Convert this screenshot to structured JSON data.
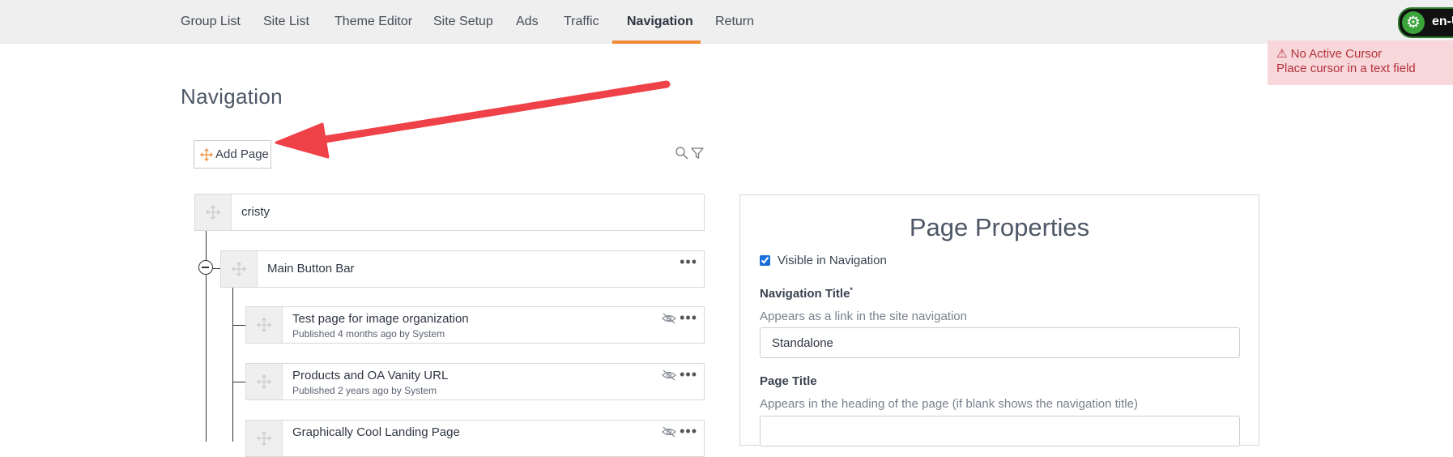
{
  "topnav": {
    "tabs": [
      {
        "label": "Group List"
      },
      {
        "label": "Site List"
      },
      {
        "label": "Theme Editor"
      },
      {
        "label": "Site Setup"
      },
      {
        "label": "Ads"
      },
      {
        "label": "Traffic"
      },
      {
        "label": "Navigation",
        "active": true
      },
      {
        "label": "Return"
      }
    ],
    "active_color": "#ef8a34",
    "language": "en-U"
  },
  "alert": {
    "icon": "warning-icon",
    "title": "⚠ No Active Cursor",
    "message": "Place cursor in a text field"
  },
  "page": {
    "title": "Navigation",
    "add_page_label": "Add Page"
  },
  "tree": {
    "root": {
      "title": "cristy"
    },
    "group": {
      "title": "Main Button Bar"
    },
    "pages": [
      {
        "title": "Test page for image organization",
        "status": "Published 4 months ago by System",
        "hidden": true
      },
      {
        "title": "Products and OA Vanity URL",
        "status": "Published 2 years ago by System",
        "hidden": true
      },
      {
        "title": "Graphically Cool Landing Page",
        "status": "",
        "hidden": true
      }
    ]
  },
  "properties": {
    "heading": "Page Properties",
    "visible_label": "Visible in Navigation",
    "visible_checked": true,
    "nav_title_label": "Navigation Title",
    "nav_title_required": "*",
    "nav_title_help": "Appears as a link in the site navigation",
    "nav_title_value": "Standalone",
    "page_title_label": "Page Title",
    "page_title_help": "Appears in the heading of the page (if blank shows the navigation title)",
    "page_title_value": ""
  },
  "colors": {
    "alert_bg": "#f8d7da",
    "alert_text": "#b4323c",
    "annotation_arrow": "#ef4148"
  }
}
